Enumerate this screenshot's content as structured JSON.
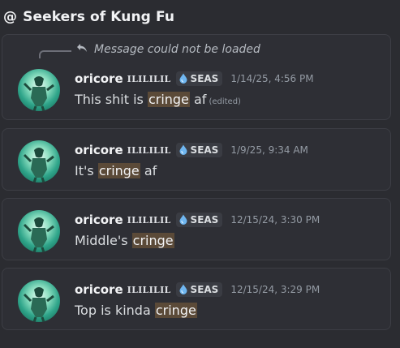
{
  "header": {
    "at_symbol": "@",
    "title": "Seekers of Kung Fu"
  },
  "reply": {
    "text": "Message could not be loaded"
  },
  "messages": [
    {
      "username": "oricore",
      "tag": "ILILILIL",
      "clan": "SEAS",
      "timestamp": "1/14/25, 4:56 PM",
      "pre": "This shit is ",
      "highlight": "cringe",
      "post": " af",
      "edited": "(edited)"
    },
    {
      "username": "oricore",
      "tag": "ILILILIL",
      "clan": "SEAS",
      "timestamp": "1/9/25, 9:34 AM",
      "pre": "It's ",
      "highlight": "cringe",
      "post": " af"
    },
    {
      "username": "oricore",
      "tag": "ILILILIL",
      "clan": "SEAS",
      "timestamp": "12/15/24, 3:30 PM",
      "pre": "Middle's ",
      "highlight": "cringe",
      "post": ""
    },
    {
      "username": "oricore",
      "tag": "ILILILIL",
      "clan": "SEAS",
      "timestamp": "12/15/24, 3:29 PM",
      "pre": "Top is kinda ",
      "highlight": "cringe",
      "post": ""
    }
  ],
  "colors": {
    "background": "#2b2c31",
    "card": "#2e2f35",
    "highlight": "#5b4a38",
    "clan_drop": "#6fb6f0"
  }
}
